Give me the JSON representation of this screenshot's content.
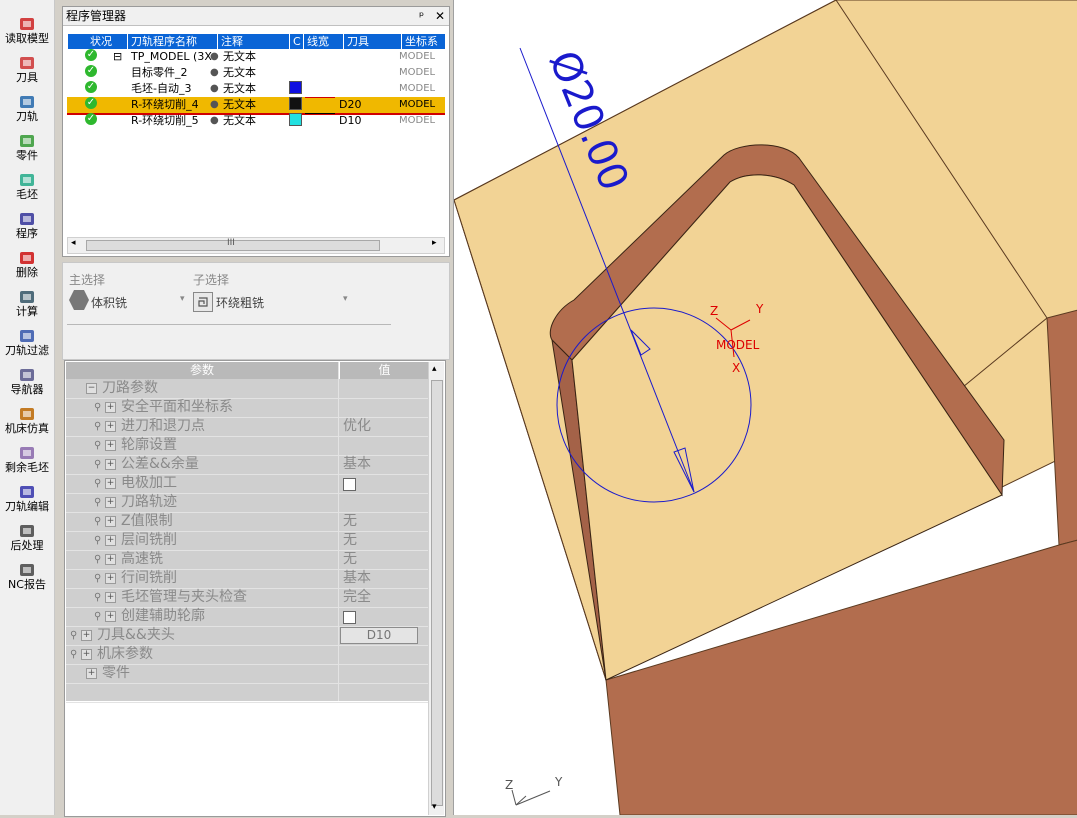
{
  "toolbar": {
    "items": [
      {
        "label": "读取模型",
        "icon": "open-model-icon"
      },
      {
        "label": "刀具",
        "icon": "tool-icon"
      },
      {
        "label": "刀轨",
        "icon": "toolpath-icon"
      },
      {
        "label": "零件",
        "icon": "part-icon"
      },
      {
        "label": "毛坯",
        "icon": "stock-icon"
      },
      {
        "label": "程序",
        "icon": "program-icon"
      },
      {
        "label": "删除",
        "icon": "delete-icon"
      },
      {
        "label": "计算",
        "icon": "compute-icon"
      },
      {
        "label": "刀轨过滤",
        "icon": "filter-icon"
      },
      {
        "label": "导航器",
        "icon": "navigator-icon"
      },
      {
        "label": "机床仿真",
        "icon": "simulation-icon"
      },
      {
        "label": "剩余毛坯",
        "icon": "remaining-stock-icon"
      },
      {
        "label": "刀轨编辑",
        "icon": "edit-toolpath-icon"
      },
      {
        "label": "后处理",
        "icon": "postprocess-icon"
      },
      {
        "label": "NC报告",
        "icon": "report-icon"
      }
    ]
  },
  "program_manager": {
    "title": "程序管理器",
    "pin": "ᵖ",
    "close": "✕",
    "columns": [
      "状况",
      "刀轨程序名称",
      "注释",
      "C",
      "线宽",
      "刀具",
      "坐标系"
    ],
    "rows": [
      {
        "tree": "⊟",
        "name": "TP_MODEL (3X",
        "note": "无文本",
        "color": "",
        "tool": "",
        "cs": "MODEL",
        "selected": false
      },
      {
        "tree": "",
        "name": "目标零件_2",
        "note": "无文本",
        "color": "",
        "tool": "",
        "cs": "MODEL",
        "selected": false
      },
      {
        "tree": "",
        "name": "毛坯-自动_3",
        "note": "无文本",
        "color": "#1010e0",
        "tool": "",
        "cs": "MODEL",
        "selected": false
      },
      {
        "tree": "",
        "name": "R-环绕切削_4",
        "note": "无文本",
        "color": "#111111",
        "tool": "D20",
        "cs": "MODEL",
        "selected": true
      },
      {
        "tree": "",
        "name": "R-环绕切削_5",
        "note": "无文本",
        "color": "#22e0e0",
        "tool": "D10",
        "cs": "MODEL",
        "selected": false
      }
    ],
    "scroll_label": "III"
  },
  "selection": {
    "main_label": "主选择",
    "main_value": "体积铣",
    "sub_label": "子选择",
    "sub_value": "环绕粗铣"
  },
  "params": {
    "header_param": "参数",
    "header_value": "值",
    "rows": [
      {
        "level": 1,
        "expander": "⊟",
        "lock": false,
        "label": "刀路参数",
        "value": "",
        "kind": "text"
      },
      {
        "level": 2,
        "expander": "⊞",
        "lock": true,
        "label": "安全平面和坐标系",
        "value": "",
        "kind": "text"
      },
      {
        "level": 2,
        "expander": "⊞",
        "lock": true,
        "label": "进刀和退刀点",
        "value": "优化",
        "kind": "text"
      },
      {
        "level": 2,
        "expander": "⊞",
        "lock": true,
        "label": "轮廓设置",
        "value": "",
        "kind": "text"
      },
      {
        "level": 2,
        "expander": "⊞",
        "lock": true,
        "label": "公差&&余量",
        "value": "基本",
        "kind": "text"
      },
      {
        "level": 2,
        "expander": "⊞",
        "lock": true,
        "label": "电极加工",
        "value": "",
        "kind": "checkbox"
      },
      {
        "level": 2,
        "expander": "⊞",
        "lock": true,
        "label": "刀路轨迹",
        "value": "",
        "kind": "text"
      },
      {
        "level": 2,
        "expander": "⊞",
        "lock": true,
        "label": "Z值限制",
        "value": "无",
        "kind": "text"
      },
      {
        "level": 2,
        "expander": "⊞",
        "lock": true,
        "label": "层间铣削",
        "value": "无",
        "kind": "text"
      },
      {
        "level": 2,
        "expander": "⊞",
        "lock": true,
        "label": "高速铣",
        "value": "无",
        "kind": "text"
      },
      {
        "level": 2,
        "expander": "⊞",
        "lock": true,
        "label": "行间铣削",
        "value": "基本",
        "kind": "text"
      },
      {
        "level": 2,
        "expander": "⊞",
        "lock": true,
        "label": "毛坯管理与夹头检查",
        "value": "完全",
        "kind": "text"
      },
      {
        "level": 2,
        "expander": "⊞",
        "lock": true,
        "label": "创建辅助轮廓",
        "value": "",
        "kind": "checkbox"
      },
      {
        "level": 0,
        "expander": "⊞",
        "lock": true,
        "label": "刀具&&夹头",
        "value": "D10",
        "kind": "button"
      },
      {
        "level": 0,
        "expander": "⊞",
        "lock": true,
        "label": "机床参数",
        "value": "",
        "kind": "text"
      },
      {
        "level": 1,
        "expander": "⊞",
        "lock": false,
        "label": "零件",
        "value": "",
        "kind": "text"
      },
      {
        "level": 0,
        "expander": "",
        "lock": false,
        "label": "",
        "value": "",
        "kind": "text"
      }
    ]
  },
  "viewport": {
    "dimension_text": "Ø20.00",
    "model_label": "MODEL",
    "axis_x": "X",
    "axis_y": "Y",
    "axis_z": "Z",
    "colors": {
      "top": "#f2d395",
      "wall": "#b26d4e",
      "side": "#c07b5a",
      "floor": "#f2d395",
      "dim": "#0000dd",
      "axes": "#dd0000"
    }
  }
}
